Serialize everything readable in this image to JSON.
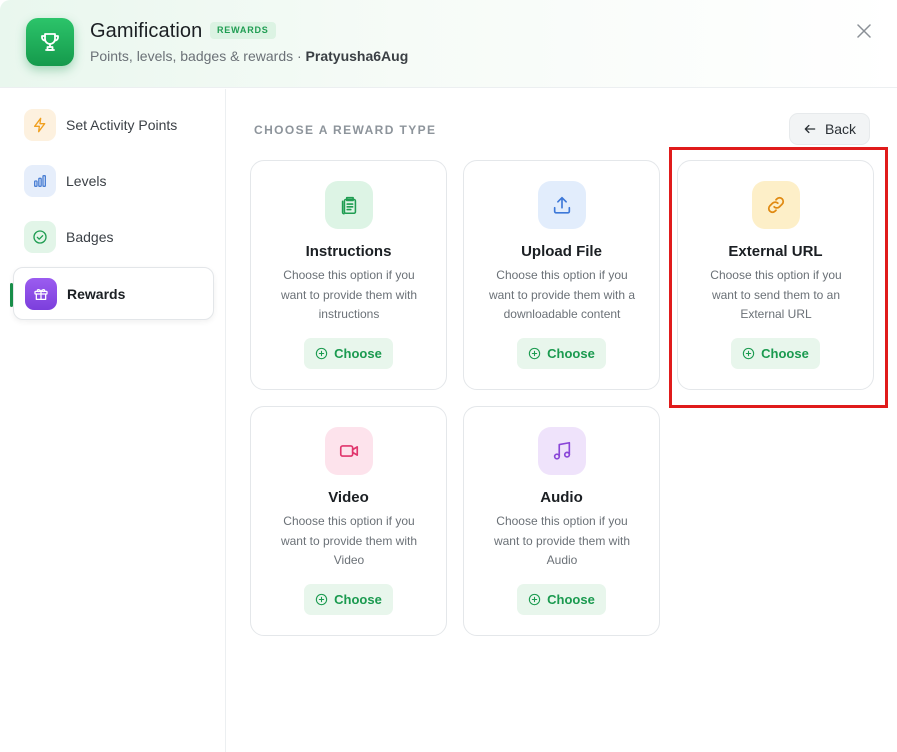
{
  "header": {
    "title": "Gamification",
    "badge": "REWARDS",
    "subtitle_prefix": "Points, levels, badges & rewards · ",
    "subtitle_user": "Pratyusha6Aug"
  },
  "sidebar": {
    "items": [
      {
        "label": "Set Activity Points",
        "icon": "lightning-icon"
      },
      {
        "label": "Levels",
        "icon": "bar-chart-icon"
      },
      {
        "label": "Badges",
        "icon": "check-circle-icon"
      },
      {
        "label": "Rewards",
        "icon": "gift-icon",
        "active": true
      }
    ]
  },
  "main": {
    "section_label": "CHOOSE A REWARD TYPE",
    "back_label": "Back",
    "cards": [
      {
        "title": "Instructions",
        "description": "Choose this option if you want to provide them with instructions",
        "button": "Choose",
        "icon": "clipboard-icon"
      },
      {
        "title": "Upload File",
        "description": "Choose this option if you want to provide them with a downloadable content",
        "button": "Choose",
        "icon": "upload-icon"
      },
      {
        "title": "External URL",
        "description": "Choose this option if you want to send them to an External URL",
        "button": "Choose",
        "icon": "link-icon"
      },
      {
        "title": "Video",
        "description": "Choose this option if you want to provide them with Video",
        "button": "Choose",
        "icon": "video-camera-icon"
      },
      {
        "title": "Audio",
        "description": "Choose this option if you want to provide them with Audio",
        "button": "Choose",
        "icon": "music-note-icon"
      }
    ]
  },
  "colors": {
    "accent": "#1a9a4f",
    "highlight": "#e01b1b"
  }
}
